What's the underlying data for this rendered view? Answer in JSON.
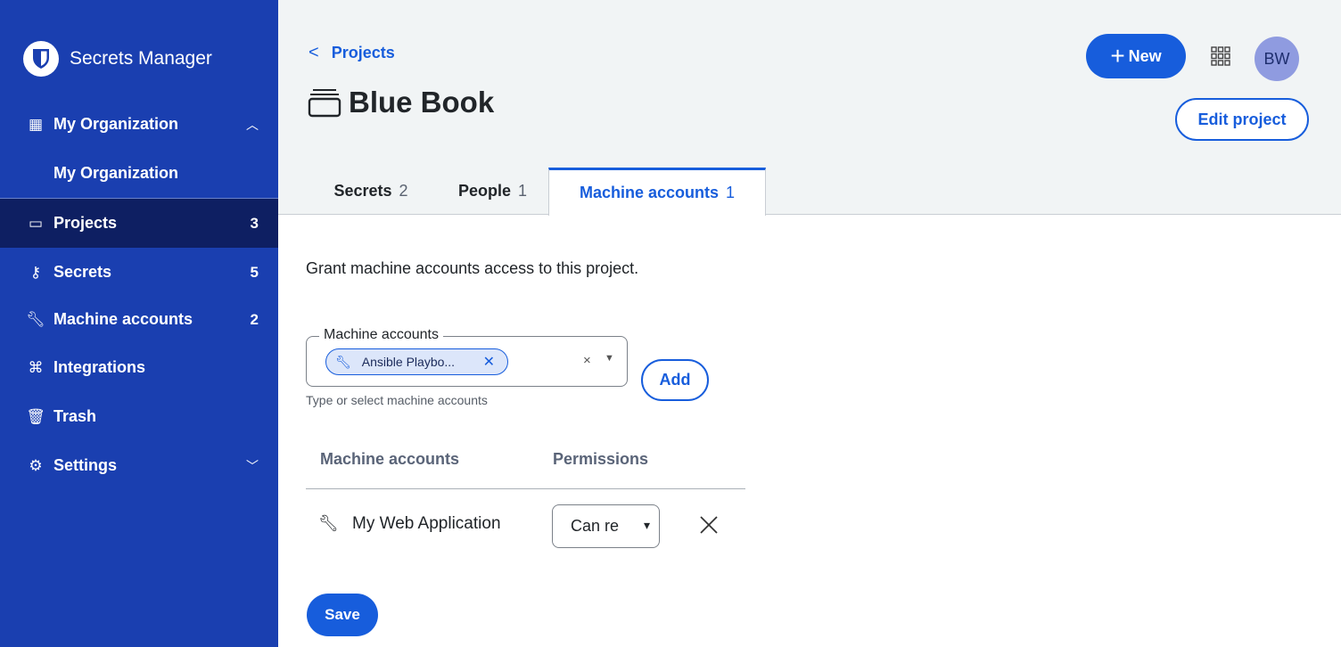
{
  "app": {
    "title": "Secrets Manager",
    "logo_icon": "shield-icon",
    "accent": "#175ddc",
    "sidebar_bg": "#1a3fb0",
    "sidebar_active_bg": "#0e1f62"
  },
  "sidebar": {
    "org_switcher": {
      "label": "My Organization",
      "icon": "building-icon",
      "expanded": true
    },
    "org_sub_item": {
      "label": "My Organization"
    },
    "items": [
      {
        "label": "Projects",
        "icon": "folder-icon",
        "count": "3",
        "active": true
      },
      {
        "label": "Secrets",
        "icon": "key-icon",
        "count": "5"
      },
      {
        "label": "Machine accounts",
        "icon": "wrench-icon",
        "count": "2"
      },
      {
        "label": "Integrations",
        "icon": "integrations-icon"
      },
      {
        "label": "Trash",
        "icon": "trash-icon"
      },
      {
        "label": "Settings",
        "icon": "gear-icon",
        "expandable": true
      }
    ]
  },
  "header": {
    "breadcrumb": "Projects",
    "title": "Blue Book",
    "new_button": "New",
    "avatar_initials": "BW",
    "edit_button": "Edit project"
  },
  "tabs": [
    {
      "label": "Secrets",
      "count": "2"
    },
    {
      "label": "People",
      "count": "1"
    },
    {
      "label": "Machine accounts",
      "count": "1",
      "active": true
    }
  ],
  "content": {
    "description": "Grant machine accounts access to this project.",
    "field": {
      "label": "Machine accounts",
      "chip": "Ansible Playbo...",
      "clear_glyph": "×",
      "hint": "Type or select machine accounts"
    },
    "add_button": "Add",
    "table": {
      "headers": [
        "Machine accounts",
        "Permissions"
      ],
      "rows": [
        {
          "name": "My Web Application",
          "permission": "Can re"
        }
      ]
    },
    "save_button": "Save"
  }
}
